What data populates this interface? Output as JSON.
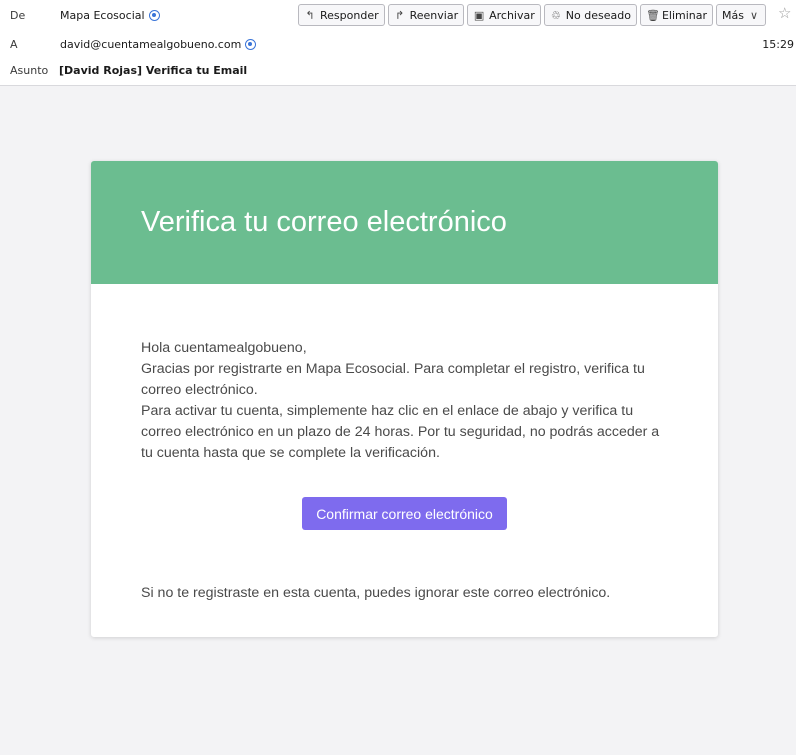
{
  "header": {
    "from": {
      "label": "De",
      "value": "Mapa Ecosocial"
    },
    "to": {
      "label": "A",
      "value": "david@cuentamealgobueno.com"
    },
    "subject": {
      "label": "Asunto",
      "value": "[David Rojas] Verifica tu Email"
    },
    "time": "15:29"
  },
  "toolbar": {
    "reply": {
      "label": "Responder",
      "icon": "reply-icon"
    },
    "forward": {
      "label": "Reenviar",
      "icon": "forward-icon"
    },
    "archive": {
      "label": "Archivar",
      "icon": "archive-icon"
    },
    "junk": {
      "label": "No deseado",
      "icon": "junk-icon"
    },
    "delete": {
      "label": "Eliminar",
      "icon": "trash-icon"
    },
    "more": {
      "label": "Más",
      "icon": "chevron-down-icon"
    }
  },
  "email": {
    "banner_title": "Verifica tu correo electrónico",
    "greeting": "Hola cuentamealgobueno,",
    "paragraph1": "Gracias por registrarte en Mapa Ecosocial. Para completar el registro, verifica tu correo electrónico.",
    "paragraph2": "Para activar tu cuenta, simplemente haz clic en el enlace de abajo y verifica tu correo electrónico en un plazo de 24 horas. Por tu seguridad, no podrás acceder a tu cuenta hasta que se complete la verificación.",
    "button_label": "Confirmar correo electrónico",
    "footer": "Si no te registraste en esta cuenta, puedes ignorar este correo electrónico."
  },
  "colors": {
    "banner": "#6bbd90",
    "button": "#7e6bee"
  }
}
